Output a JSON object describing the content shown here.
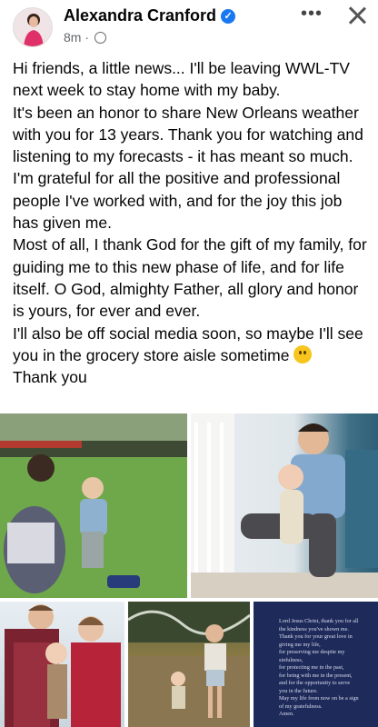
{
  "post": {
    "author": "Alexandra Cranford",
    "verified_icon": "verified-badge-icon",
    "time": "8m",
    "audience_icon": "globe-icon",
    "more_icon": "more-options-icon",
    "close_icon": "close-icon",
    "lines": [
      "Hi friends, a little news... I'll be leaving WWL-TV next week to stay home with my baby.",
      "It's been an honor to share New Orleans weather with you for 13 years. Thank you for watching and listening to my forecasts - it has meant so much.",
      "I'm grateful for all the positive and professional people I've worked with, and for the joy this job has given me.",
      "Most of all, I thank God for the gift of my family, for guiding me to this new phase of life, and for life itself. O God, almighty Father, all glory and honor is yours, for ever and ever.",
      "I'll also be off social media soon, so maybe I'll see you in the grocery store aisle sometime",
      "Thank you"
    ],
    "emoji": "slightly-smiling-face-icon"
  },
  "photos": {
    "prayer_lines": [
      "Lord Jesus Christ, thank you for all",
      "the kindness you've shown me.",
      "Thank you for your great love in",
      "giving me my life,",
      "for preserving me despite my",
      "sinfulness,",
      "for protecting me in the past,",
      "for being with me in the present,",
      "and for the opportunity to serve",
      "you in the future.",
      "May my life from now on be a sign",
      "of my gratefulness.",
      "Amen."
    ]
  },
  "colors": {
    "accent": "#1877f2",
    "secondary_text": "#65676b",
    "prayer_background": "#1e2a5a"
  }
}
